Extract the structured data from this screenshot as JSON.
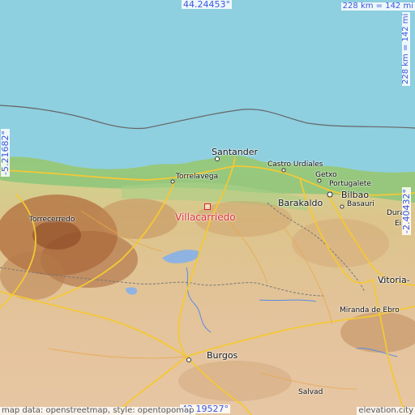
{
  "map": {
    "bounds": {
      "north": "44.24453°",
      "south": "42.19527°",
      "west": "-5.21682°",
      "east": "-2.40432°"
    },
    "scale": {
      "top": "228 km = 142 mi",
      "right": "228 km = 142 mi"
    },
    "focus_place": "Villacarriedo",
    "places": {
      "santander": "Santander",
      "castro_urdiales": "Castro Urdiales",
      "getxo": "Getxo",
      "portugalete": "Portugalete",
      "bilbao": "Bilbao",
      "barakaldo": "Barakaldo",
      "basauri": "Basauri",
      "durango": "Dura",
      "eibar": "Eil",
      "torrelavega": "Torrelavega",
      "torrecerredo": "Torrecerredo",
      "vitoria": "Vitoria-",
      "miranda": "Miranda de Ebro",
      "burgos": "Burgos",
      "salvador": "Salvad"
    },
    "attribution": {
      "left": "map data: openstreetmap, style: opentopomap",
      "right": "elevation.city"
    },
    "colors": {
      "sea": "#8ecfe0",
      "lowland": "#7cc27a",
      "hills": "#e3c88e",
      "mountains": "#b0713f",
      "roads": "#f5c835",
      "label": "#3b55e0",
      "marker": "#d9262c"
    }
  }
}
